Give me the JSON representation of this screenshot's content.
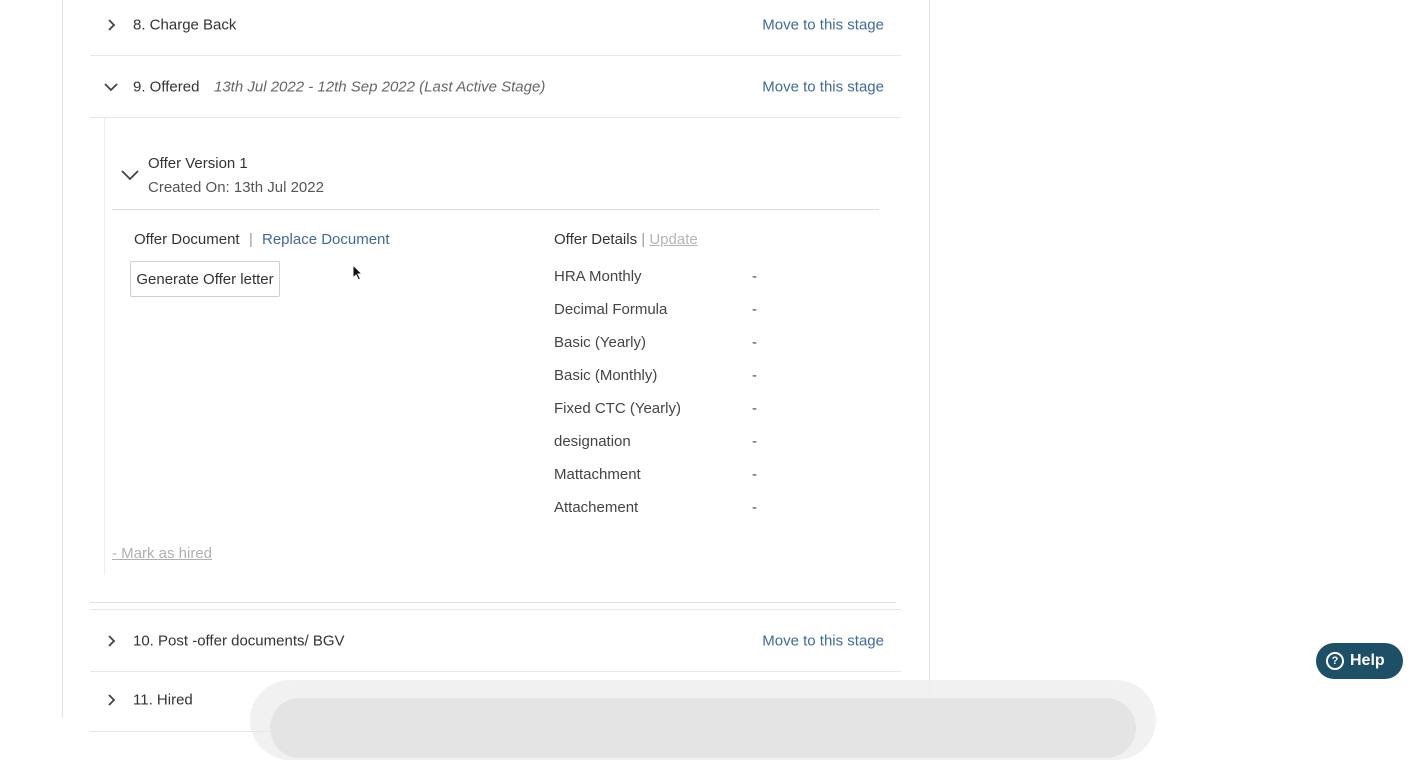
{
  "stages": {
    "charge_back": {
      "name": "8. Charge Back",
      "action": "Move to this stage"
    },
    "offered": {
      "name": "9. Offered",
      "dates": "13th Jul 2022 - 12th Sep 2022 (Last Active Stage)",
      "action": "Move to this stage"
    },
    "post_offer": {
      "name": "10. Post -offer documents/ BGV",
      "action": "Move to this stage"
    },
    "hired": {
      "name": "11. Hired"
    }
  },
  "offer": {
    "version_title": "Offer Version 1",
    "created_on": "Created On: 13th Jul 2022",
    "document_label": "Offer Document",
    "pipe": "|",
    "replace_link": "Replace Document",
    "generate_button": "Generate Offer letter",
    "details_label": "Offer Details",
    "details_sep": "|",
    "update_link": "Update",
    "fields": [
      {
        "label": "HRA Monthly",
        "value": "-"
      },
      {
        "label": "Decimal Formula",
        "value": "-"
      },
      {
        "label": "Basic (Yearly)",
        "value": "-"
      },
      {
        "label": "Basic (Monthly)",
        "value": "-"
      },
      {
        "label": "Fixed CTC (Yearly)",
        "value": "-"
      },
      {
        "label": "designation",
        "value": "-"
      },
      {
        "label": "Mattachment",
        "value": "-"
      },
      {
        "label": "Attachement",
        "value": "-"
      }
    ],
    "mark_hired": "- Mark as hired"
  },
  "help": {
    "label": "Help"
  },
  "icons": {
    "collapsed": "chevron-right-icon",
    "expanded": "chevron-down-icon",
    "help": "question-circle-icon"
  },
  "colors": {
    "link": "#3f6a9a",
    "help_bg": "#1d4f66",
    "disabled": "#b0b0b0"
  }
}
